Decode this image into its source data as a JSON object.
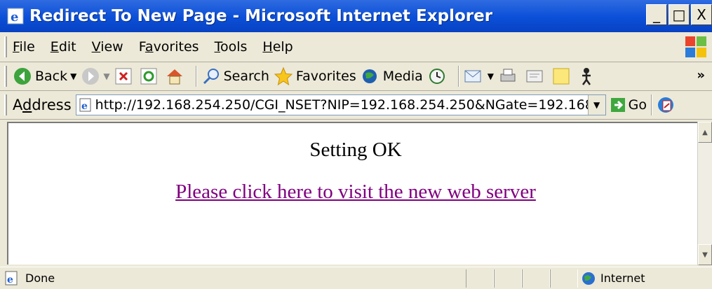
{
  "window": {
    "title": "Redirect To New Page - Microsoft Internet Explorer"
  },
  "window_controls": {
    "minimize": "_",
    "maximize": "□",
    "close": "X"
  },
  "menu": [
    {
      "accel": "F",
      "rest": "ile"
    },
    {
      "accel": "E",
      "rest": "dit"
    },
    {
      "accel": "V",
      "rest": "iew"
    },
    {
      "pre": "F",
      "accel": "a",
      "rest": "vorites"
    },
    {
      "accel": "T",
      "rest": "ools"
    },
    {
      "accel": "H",
      "rest": "elp"
    }
  ],
  "toolbar": {
    "back": "Back",
    "search": "Search",
    "favorites": "Favorites",
    "media": "Media",
    "more": "»"
  },
  "address": {
    "label_pre": "A",
    "label_accel": "d",
    "label_rest": "dress",
    "url": "http://192.168.254.250/CGI_NSET?NIP=192.168.254.250&NGate=192.168",
    "go": "Go"
  },
  "page": {
    "heading": "Setting OK",
    "link_text": "Please click here to visit the new web server"
  },
  "status": {
    "text": "Done",
    "zone": "Internet"
  },
  "colors": {
    "title_bar": "#0A4FD8",
    "visited_link": "#800080",
    "chrome": "#ECE9D8"
  }
}
